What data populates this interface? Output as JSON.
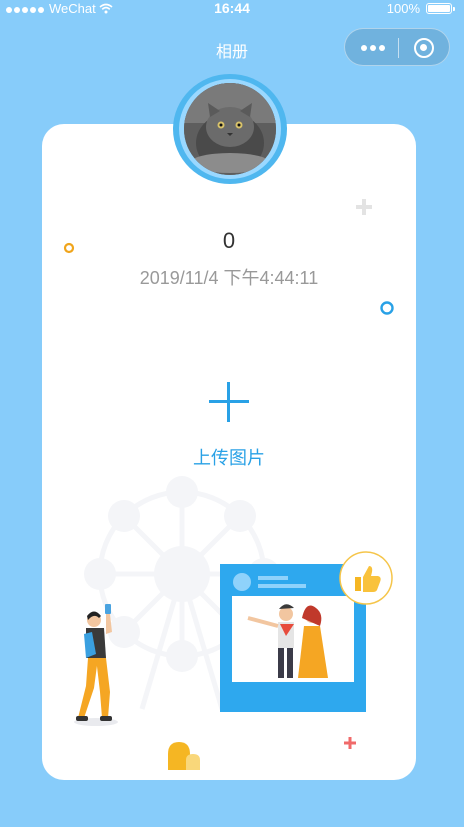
{
  "status_bar": {
    "carrier": "WeChat",
    "time": "16:44",
    "battery": "100%"
  },
  "nav": {
    "title": "相册"
  },
  "card": {
    "count": "0",
    "datetime": "2019/11/4 下午4:44:11",
    "upload_label": "上传图片"
  },
  "icons": {
    "signal": "signal-dots-icon",
    "wifi": "wifi-icon",
    "battery": "battery-icon",
    "more": "more-dots-icon",
    "close": "capsule-target-icon",
    "upload": "plus-icon",
    "thumbs_up": "thumbs-up-icon"
  },
  "colors": {
    "background": "#87ccfa",
    "accent": "#29a1e6",
    "card": "#ffffff"
  }
}
